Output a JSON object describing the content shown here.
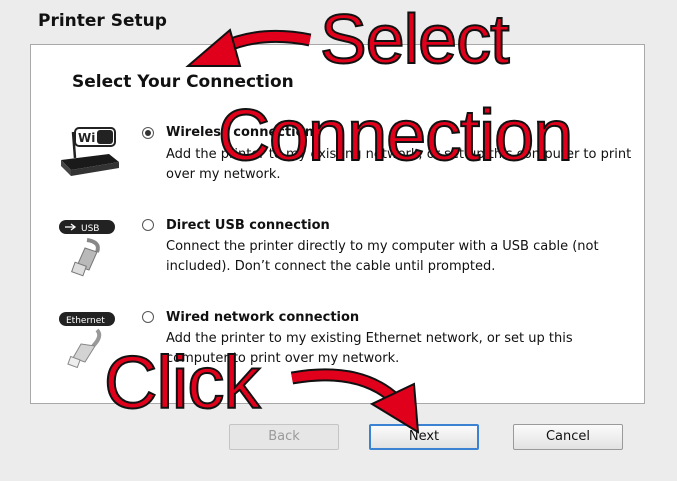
{
  "window": {
    "title": "Printer Setup"
  },
  "panel": {
    "heading": "Select Your Connection"
  },
  "options": [
    {
      "icon": "wifi-router-icon",
      "badge": "Wi Fi",
      "selected": true,
      "label": "Wireless connection",
      "description": "Add the printer to my existing network, or set up this computer to print over my network."
    },
    {
      "icon": "usb-cable-icon",
      "badge": "USB",
      "selected": false,
      "label": "Direct USB connection",
      "description": "Connect the printer directly to my computer with a USB cable (not included). Don’t connect the cable until prompted."
    },
    {
      "icon": "ethernet-cable-icon",
      "badge": "Ethernet",
      "selected": false,
      "label": "Wired network connection",
      "description": "Add the printer to my existing Ethernet network, or set up this computer to print over my network."
    }
  ],
  "buttons": {
    "back": "Back",
    "next": "Next",
    "cancel": "Cancel"
  },
  "annotations": {
    "select_line1": "Select",
    "select_line2": "Connection",
    "click": "Click",
    "color": "#e1001b"
  }
}
